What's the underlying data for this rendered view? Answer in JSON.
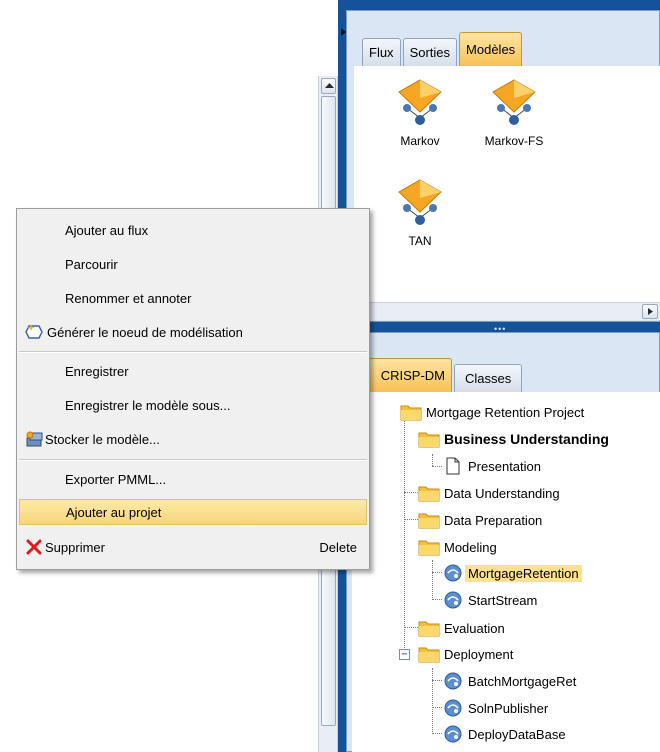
{
  "model_palette": {
    "tabs": [
      "Flux",
      "Sorties",
      "Modèles"
    ],
    "active_tab": "Modèles",
    "models": [
      "Markov",
      "Markov-FS",
      "TAN"
    ]
  },
  "project_pane": {
    "tabs": [
      "CRISP-DM",
      "Classes"
    ],
    "active_tab": "CRISP-DM",
    "tree": {
      "root": "Mortgage Retention Project",
      "business_understanding": "Business Understanding",
      "presentation": "Presentation",
      "data_understanding": "Data Understanding",
      "data_preparation": "Data Preparation",
      "modeling": "Modeling",
      "mortgage_retention": "MortgageRetention",
      "start_stream": "StartStream",
      "evaluation": "Evaluation",
      "deployment": "Deployment",
      "batch_mortgage_ret": "BatchMortgageRet",
      "soln_publisher": "SolnPublisher",
      "deploy_database": "DeployDataBase"
    }
  },
  "context_menu": {
    "items": [
      {
        "label": "Ajouter au flux",
        "icon": "none"
      },
      {
        "label": "Parcourir",
        "icon": "none"
      },
      {
        "label": "Renommer et annoter",
        "icon": "none"
      },
      {
        "label": "Générer le noeud de modélisation",
        "icon": "generate-node-icon"
      },
      {
        "label": "Enregistrer",
        "icon": "none"
      },
      {
        "label": "Enregistrer le modèle sous...",
        "icon": "none"
      },
      {
        "label": "Stocker le modèle...",
        "icon": "store-model-icon"
      },
      {
        "label": "Exporter PMML...",
        "icon": "none"
      },
      {
        "label": "Ajouter au projet",
        "icon": "none",
        "highlighted": true
      },
      {
        "label": "Supprimer",
        "icon": "delete-x-icon",
        "shortcut": "Delete"
      }
    ]
  },
  "colors": {
    "frame_blue": "#14539c",
    "pane_background": "#dbe6f4",
    "active_tab": "#f9c253",
    "menu_highlight": "#f8d57a",
    "selection": "#fde18e",
    "delete_red": "#e01a1a"
  }
}
